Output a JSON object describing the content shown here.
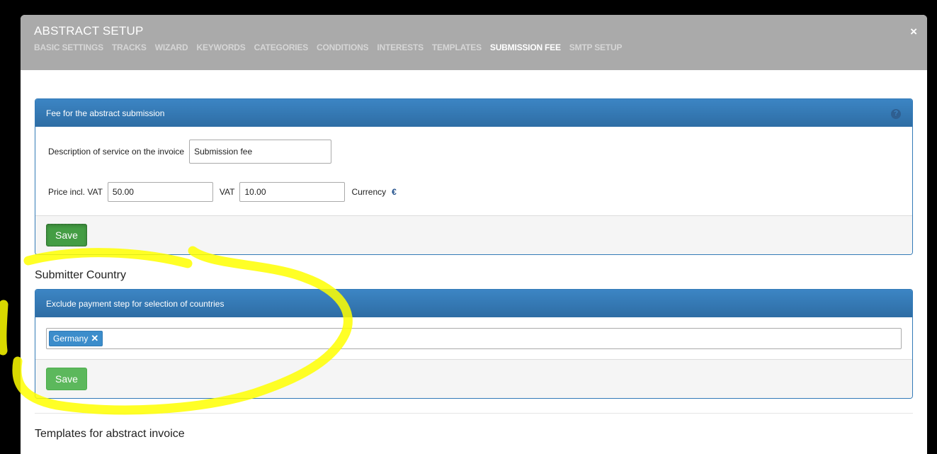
{
  "modal": {
    "title": "ABSTRACT SETUP",
    "close_label": "×",
    "tabs": [
      {
        "label": "BASIC SETTINGS",
        "active": false
      },
      {
        "label": "TRACKS",
        "active": false
      },
      {
        "label": "WIZARD",
        "active": false
      },
      {
        "label": "KEYWORDS",
        "active": false
      },
      {
        "label": "CATEGORIES",
        "active": false
      },
      {
        "label": "CONDITIONS",
        "active": false
      },
      {
        "label": "INTERESTS",
        "active": false
      },
      {
        "label": "TEMPLATES",
        "active": false
      },
      {
        "label": "SUBMISSION FEE",
        "active": true
      },
      {
        "label": "SMTP SETUP",
        "active": false
      }
    ]
  },
  "fee_panel": {
    "heading": "Fee for the abstract submission",
    "help_label": "?",
    "description_label": "Description of service on the invoice",
    "description_value": "Submission fee",
    "price_label": "Price incl. VAT",
    "price_value": "50.00",
    "vat_label": "VAT",
    "vat_value": "10.00",
    "currency_label": "Currency",
    "currency_value": "€",
    "save_label": "Save"
  },
  "country_section": {
    "title": "Submitter Country",
    "heading": "Exclude payment step for selection of countries",
    "tags": [
      "Germany"
    ],
    "tag_remove": "✕",
    "save_label": "Save"
  },
  "templates_section": {
    "title": "Templates for abstract invoice"
  },
  "colors": {
    "header_bg": "#aaaaaa",
    "panel_blue": "#337ab7",
    "save_green": "#5cb85c",
    "highlight": "#ffff00"
  }
}
